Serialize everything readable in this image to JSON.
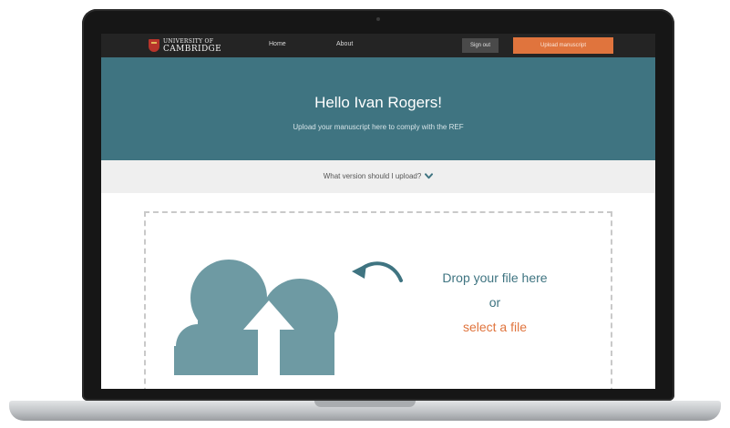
{
  "nav": {
    "logo_line1": "UNIVERSITY OF",
    "logo_line2": "CAMBRIDGE",
    "home": "Home",
    "about": "About",
    "sign_out": "Sign out",
    "upload_button": "Upload manuscript"
  },
  "hero": {
    "title": "Hello Ivan Rogers!",
    "subtitle": "Upload your manuscript here to comply with the REF"
  },
  "version": {
    "label": "What version should I upload?",
    "icon": "chevron-down-icon"
  },
  "dropzone": {
    "line1": "Drop your file here",
    "line2": "or",
    "select_link": "select a file",
    "icons": [
      "cloud-upload-icon",
      "curved-arrow-icon"
    ]
  },
  "colors": {
    "teal": "#3f7481",
    "orange": "#e0743d",
    "navbar": "#242424",
    "version_bar": "#efefef",
    "cloud": "#6e9aa3"
  }
}
